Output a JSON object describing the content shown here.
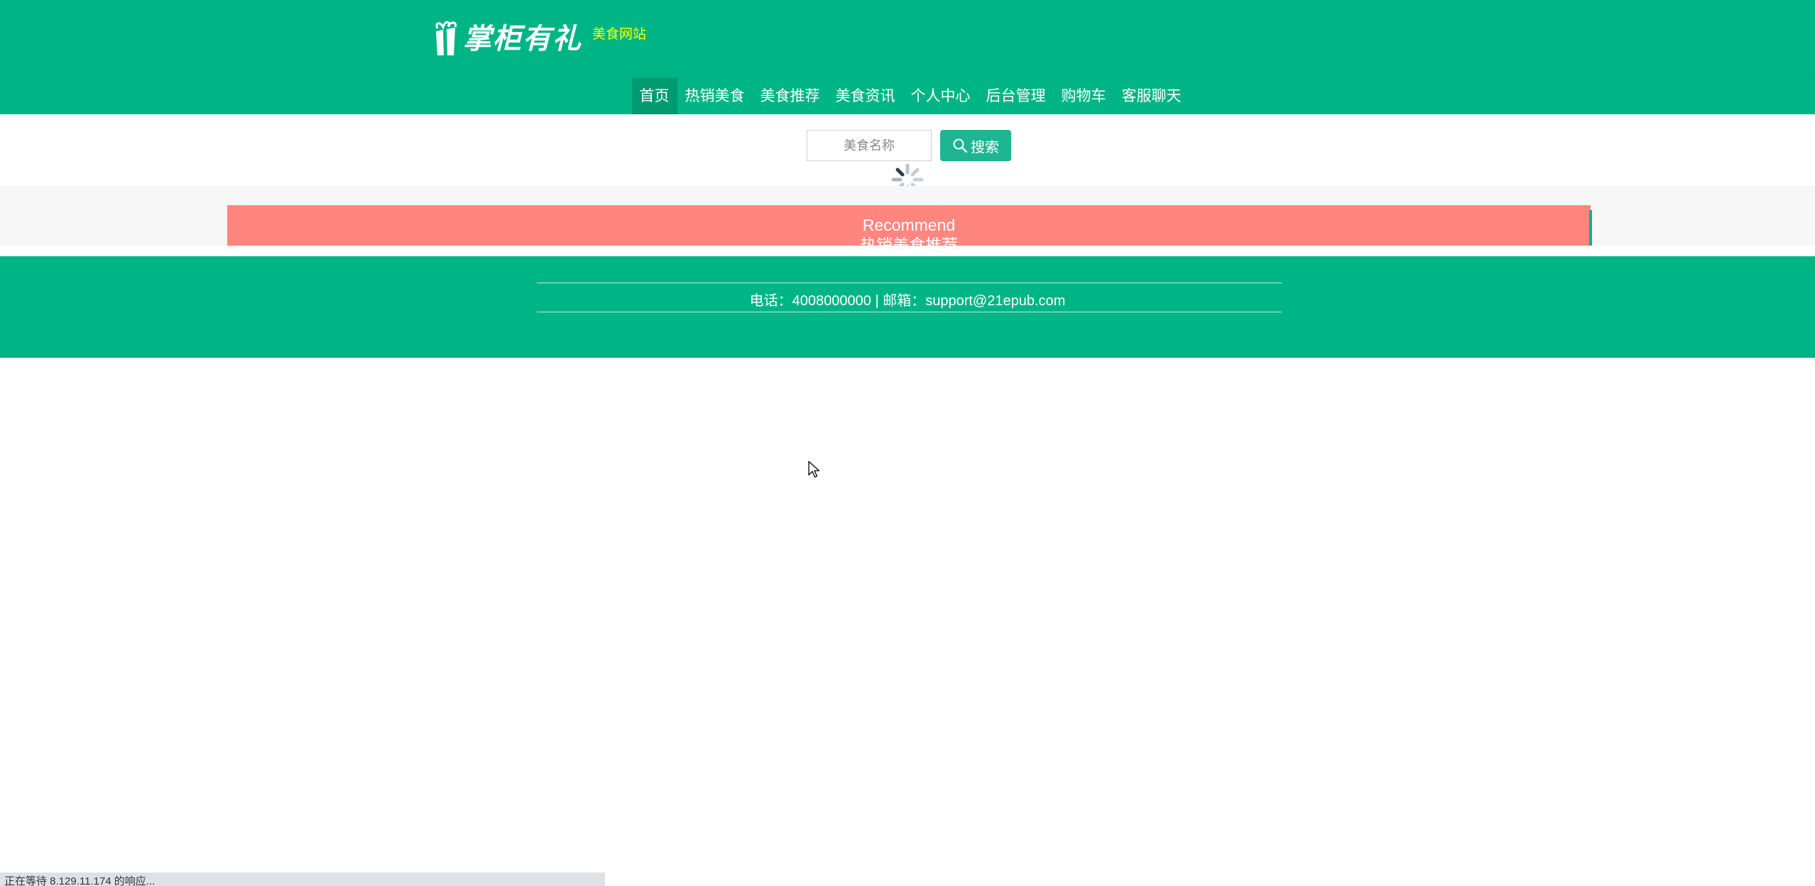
{
  "header": {
    "logo_text": "掌柜有礼",
    "site_subtitle": "美食网站",
    "brand_color": "#00b585",
    "subtitle_color": "#ffff00"
  },
  "nav": {
    "items": [
      {
        "label": "首页",
        "active": true
      },
      {
        "label": "热销美食",
        "active": false
      },
      {
        "label": "美食推荐",
        "active": false
      },
      {
        "label": "美食资讯",
        "active": false
      },
      {
        "label": "个人中心",
        "active": false
      },
      {
        "label": "后台管理",
        "active": false
      },
      {
        "label": "购物车",
        "active": false
      },
      {
        "label": "客服聊天",
        "active": false
      }
    ]
  },
  "search": {
    "placeholder": "美食名称",
    "value": "",
    "button_label": "搜索",
    "button_icon": "search-icon"
  },
  "loading": {
    "icon": "spinner-icon"
  },
  "recommend": {
    "title": "Recommend",
    "subtitle": "热销美食推荐",
    "background_color": "#ff867f"
  },
  "footer": {
    "contact": "电话：4008000000 | 邮箱：support@21epub.com"
  },
  "status_bar": {
    "text": "正在等待 8.129.11.174 的响应..."
  }
}
